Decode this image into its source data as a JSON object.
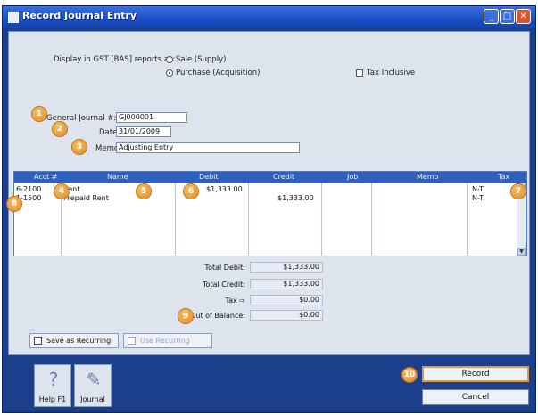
{
  "window": {
    "title": "Record Journal Entry",
    "controls": {
      "minimize": "_",
      "maximize": "□",
      "close": "✕"
    }
  },
  "gst": {
    "label": "Display in GST [BAS] reports as:",
    "option_sale": "Sale (Supply)",
    "option_purchase": "Purchase (Acquisition)",
    "selected": "purchase",
    "tax_inclusive_label": "Tax Inclusive",
    "tax_inclusive_checked": false
  },
  "header": {
    "journal_label": "General Journal #:",
    "journal_value": "GJ000001",
    "date_label": "Date:",
    "date_value": "31/01/2009",
    "memo_label": "Memo:",
    "memo_value": "Adjusting Entry"
  },
  "grid": {
    "columns": [
      "Acct #",
      "Name",
      "Debit",
      "Credit",
      "Job",
      "Memo",
      "Tax"
    ],
    "rows": [
      {
        "acct": "6-2100",
        "name": "Rent",
        "debit": "$1,333.00",
        "credit": "",
        "job": "",
        "memo": "",
        "tax": "N-T"
      },
      {
        "acct": "1-1500",
        "name": "Prepaid Rent",
        "debit": "",
        "credit": "$1,333.00",
        "job": "",
        "memo": "",
        "tax": "N-T"
      }
    ]
  },
  "totals": {
    "debit_label": "Total Debit:",
    "debit_value": "$1,333.00",
    "credit_label": "Total Credit:",
    "credit_value": "$1,333.00",
    "tax_label": "Tax ⇨",
    "tax_value": "$0.00",
    "oob_label": "Out of Balance:",
    "oob_value": "$0.00"
  },
  "buttons": {
    "save_recurring": "Save as Recurring",
    "use_recurring": "Use Recurring",
    "help": "Help F1",
    "journal": "Journal",
    "record": "Record",
    "cancel": "Cancel"
  },
  "callouts": [
    "1",
    "2",
    "3",
    "4",
    "5",
    "6",
    "7",
    "8",
    "9",
    "10"
  ],
  "colors": {
    "accent": "#1c3f8c",
    "callout": "#e08a1e",
    "grid_header": "#2f5fbf"
  },
  "icons": {
    "help": "question-mark-icon",
    "journal": "journal-book-icon",
    "scroll_up": "scroll-up-icon",
    "scroll_down": "scroll-down-icon"
  }
}
